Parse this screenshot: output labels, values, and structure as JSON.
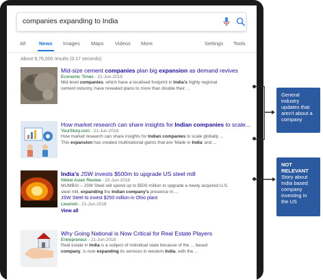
{
  "search": {
    "query": "companies expanding to India"
  },
  "tabs": [
    {
      "label": "All"
    },
    {
      "label": "News"
    },
    {
      "label": "Images"
    },
    {
      "label": "Maps"
    },
    {
      "label": "Videos"
    },
    {
      "label": "More"
    },
    {
      "label": "Settings"
    },
    {
      "label": "Tools"
    }
  ],
  "stats": "About 9,76,000 results (0.17 seconds)",
  "results": [
    {
      "title_pre": "Mid-size cement ",
      "title_b1": "companies",
      "title_mid": " plan big ",
      "title_b2": "expansion",
      "title_post": " as demand revives",
      "source": "Economic Times",
      "date": " - 21-Jun-2018",
      "snippet_1": "Mid-level ",
      "snippet_1b": "companies",
      "snippet_1c": ", which have a localised footprint in ",
      "snippet_1d": "India's",
      "snippet_1e": " highly regional",
      "snippet_2": "cement industry, have revealed plans to more than double their ..."
    },
    {
      "title_pre": "How market research can share insights for ",
      "title_b1": "Indian companies",
      "title_post": " to scale...",
      "source": "YourStory.com",
      "date": " - 21-Jun-2018",
      "snippet_1": "How market research can share insights for ",
      "snippet_1b": "Indian companies",
      "snippet_1c": " to scale globally ...",
      "snippet_2": "This ",
      "snippet_2b": "expansion",
      "snippet_2c": " has created multinational giants that are 'Made in ",
      "snippet_2d": "India",
      "snippet_2e": "' and ..."
    },
    {
      "title_b1": "India's",
      "title_post": " JSW invests $500m to upgrade US steel mill",
      "source": "Nikkei Asian Review",
      "date": " - 22-Jun-2018",
      "snippet_1": "MUMBAI – JSW Steel will spend up to $500 million to upgrade a newly acquired U.S.",
      "snippet_2": "steel mill, ",
      "snippet_2b": "expanding",
      "snippet_2c": " the ",
      "snippet_2d": "Indian company's",
      "snippet_2e": " presence in ...",
      "sublink": "JSW Steel to invest $250 million in Ohio plant",
      "sublink_source": "Livemint",
      "sublink_date": " - 21-Jun-2018",
      "view_all": "View all"
    },
    {
      "title": "Why Going National is Now Critical for Real Estate Players",
      "source": "Entrepreneur",
      "date": " - 21-Jun-2018",
      "snippet_1": "Real estate in ",
      "snippet_1b": "India",
      "snippet_1c": " is a subject of individual state because of the ... based",
      "snippet_2": "company",
      "snippet_2b": ", is now ",
      "snippet_2c": "expanding",
      "snippet_2d": " its services in western ",
      "snippet_2e": "India",
      "snippet_2f": ", with the ..."
    }
  ],
  "callouts": [
    {
      "text": "General industry updates that aren't about a company"
    },
    {
      "heading": "NOT RELEVANT",
      "text": "Story about India based company investing in the US"
    }
  ],
  "colors": {
    "accent": "#1a73e8",
    "callout": "#2c5aa0",
    "link": "#1a0dab",
    "source": "#006621"
  }
}
